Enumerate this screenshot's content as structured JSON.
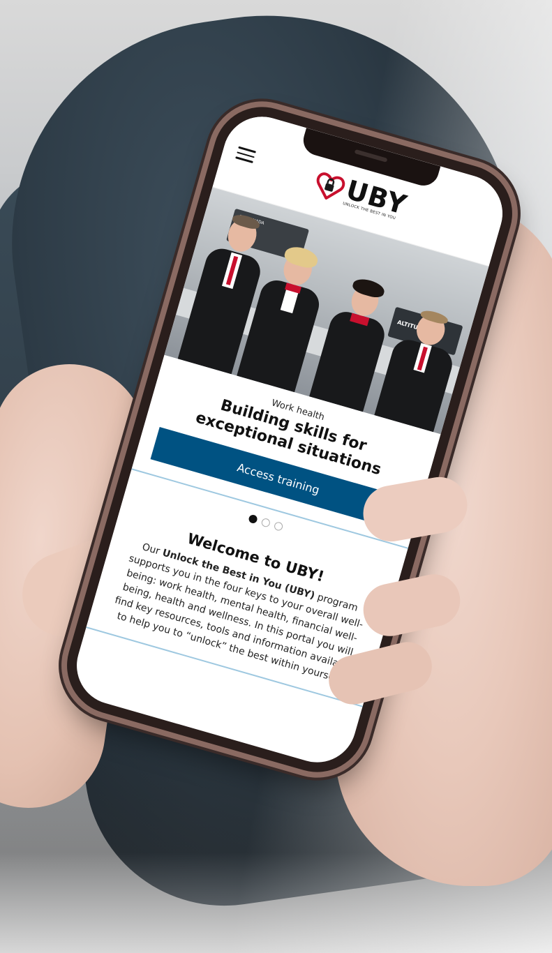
{
  "site": {
    "logo_word": "UBY",
    "logo_tagline": "UNLOCK THE BEST IN YOU",
    "brand_color": "#005282",
    "accent_red": "#c8102e"
  },
  "hero": {
    "sign_left": "AIR CANADA",
    "sign_right": "ALTITUDE"
  },
  "slide": {
    "kicker": "Work health",
    "headline": "Building skills for exceptional situations",
    "cta_label": "Access training",
    "dots": 3,
    "active_dot": 0
  },
  "intro": {
    "title": "Welcome to UBY!",
    "body_prefix": "Our ",
    "body_bold": "Unlock the Best in You (UBY)",
    "body_rest": " program supports you in the four keys to your overall well-being: work health, mental health, financial well-being, health and wellness. In this portal you will find key resources, tools and information available to help you to “unlock” the best within yourself."
  },
  "icons": [
    "menu-icon",
    "heart-lock-icon"
  ]
}
